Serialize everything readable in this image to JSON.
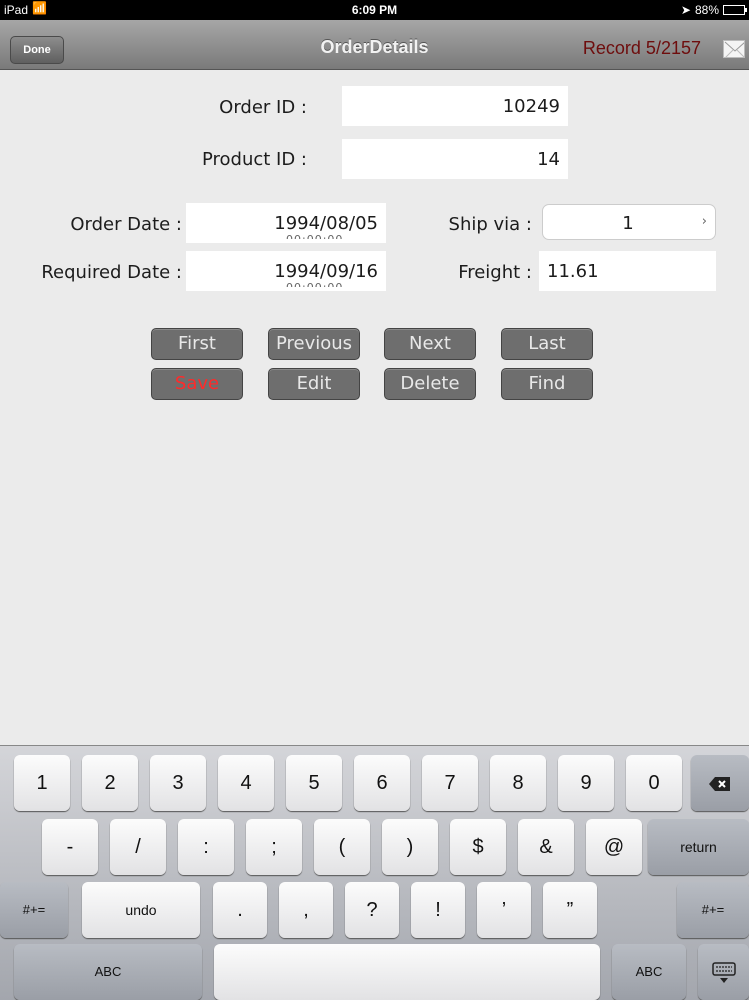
{
  "status_bar": {
    "carrier": "iPad",
    "time": "6:09 PM",
    "battery": "88%",
    "battery_level": 0.88
  },
  "nav": {
    "done_label": "Done",
    "title": "OrderDetails",
    "record": "Record 5/2157"
  },
  "form": {
    "order_id": {
      "label": "Order ID :",
      "value": "10249"
    },
    "product_id": {
      "label": "Product ID :",
      "value": "14"
    },
    "order_date": {
      "label": "Order Date :",
      "value": "1994/08/05"
    },
    "required_date": {
      "label": "Required Date :",
      "value": "1994/09/16"
    },
    "ship_via": {
      "label": "Ship via :",
      "value": "1"
    },
    "freight": {
      "label": "Freight :",
      "value": "11.61"
    }
  },
  "buttons": {
    "first": "First",
    "previous": "Previous",
    "next": "Next",
    "last": "Last",
    "save": "Save",
    "edit": "Edit",
    "delete": "Delete",
    "find": "Find"
  },
  "colors": {
    "save_text": "#ff2a2a",
    "record_text": "#6e0d0d",
    "button_bg": "#6e6e6e"
  },
  "keyboard": {
    "row1": [
      "1",
      "2",
      "3",
      "4",
      "5",
      "6",
      "7",
      "8",
      "9",
      "0"
    ],
    "row2": [
      "-",
      "/",
      ":",
      ";",
      "(",
      ")",
      "$",
      "&",
      "@"
    ],
    "return_label": "return",
    "symbols_label": "#+=",
    "undo_label": "undo",
    "row3": [
      ".",
      ",",
      "?",
      "!",
      "’",
      "”"
    ],
    "abc_label": "ABC"
  }
}
